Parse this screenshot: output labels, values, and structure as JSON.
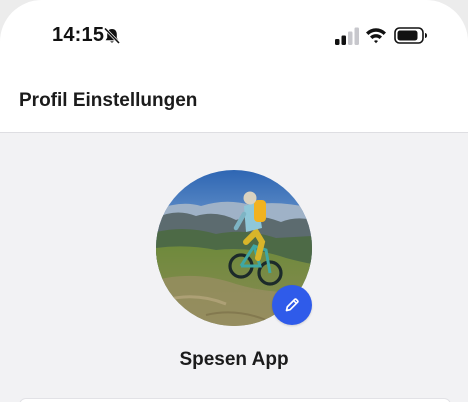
{
  "status_bar": {
    "time": "14:15",
    "icons": [
      "bell-slash-icon",
      "cellular-signal-icon",
      "wifi-icon",
      "battery-icon"
    ]
  },
  "header": {
    "title": "Profil Einstellungen"
  },
  "profile": {
    "name": "Spesen App",
    "edit_icon": "pencil-icon"
  },
  "colors": {
    "accent": "#2f5bea",
    "background": "#f2f2f4",
    "header_bg": "#ffffff"
  }
}
